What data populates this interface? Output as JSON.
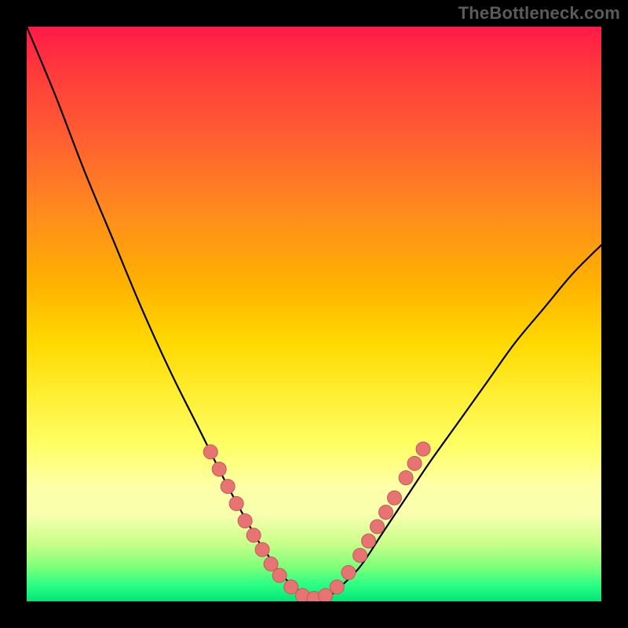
{
  "watermark": "TheBottleneck.com",
  "colors": {
    "curve_stroke": "#000000",
    "dot_fill": "#e77373",
    "dot_stroke": "#c45a5a",
    "background_black": "#000000"
  },
  "chart_data": {
    "type": "line",
    "title": "",
    "xlabel": "",
    "ylabel": "",
    "xlim": [
      0,
      100
    ],
    "ylim": [
      0,
      100
    ],
    "x": [
      0,
      5,
      10,
      15,
      20,
      25,
      30,
      35,
      40,
      42,
      44,
      46,
      48,
      50,
      52,
      54,
      58,
      62,
      66,
      70,
      75,
      80,
      85,
      90,
      95,
      100
    ],
    "values": [
      100,
      88,
      75,
      63,
      51,
      40,
      30,
      20,
      11,
      8,
      5,
      3,
      1.5,
      0.5,
      0.5,
      2,
      6,
      12,
      18,
      24,
      31,
      38,
      45,
      51,
      57,
      62
    ],
    "series": [
      {
        "name": "curve",
        "x": [
          0,
          5,
          10,
          15,
          20,
          25,
          30,
          35,
          40,
          42,
          44,
          46,
          48,
          50,
          52,
          54,
          58,
          62,
          66,
          70,
          75,
          80,
          85,
          90,
          95,
          100
        ],
        "y": [
          100,
          88,
          75,
          63,
          51,
          40,
          30,
          20,
          11,
          8,
          5,
          3,
          1.5,
          0.5,
          0.5,
          2,
          6,
          12,
          18,
          24,
          31,
          38,
          45,
          51,
          57,
          62
        ]
      }
    ],
    "dots": [
      {
        "x": 32,
        "y": 26
      },
      {
        "x": 33.5,
        "y": 23
      },
      {
        "x": 35,
        "y": 20
      },
      {
        "x": 36.5,
        "y": 17
      },
      {
        "x": 38,
        "y": 14
      },
      {
        "x": 39.5,
        "y": 11.5
      },
      {
        "x": 41,
        "y": 9
      },
      {
        "x": 42.5,
        "y": 6.5
      },
      {
        "x": 44,
        "y": 4.5
      },
      {
        "x": 46,
        "y": 2.5
      },
      {
        "x": 48,
        "y": 1.0
      },
      {
        "x": 50,
        "y": 0.5
      },
      {
        "x": 52,
        "y": 1.0
      },
      {
        "x": 54,
        "y": 2.5
      },
      {
        "x": 56,
        "y": 5.0
      },
      {
        "x": 58,
        "y": 8.0
      },
      {
        "x": 59.5,
        "y": 10.5
      },
      {
        "x": 61,
        "y": 13.0
      },
      {
        "x": 62.5,
        "y": 15.5
      },
      {
        "x": 64,
        "y": 18.0
      },
      {
        "x": 66,
        "y": 21.5
      },
      {
        "x": 67.5,
        "y": 24.0
      },
      {
        "x": 69,
        "y": 26.5
      }
    ]
  }
}
